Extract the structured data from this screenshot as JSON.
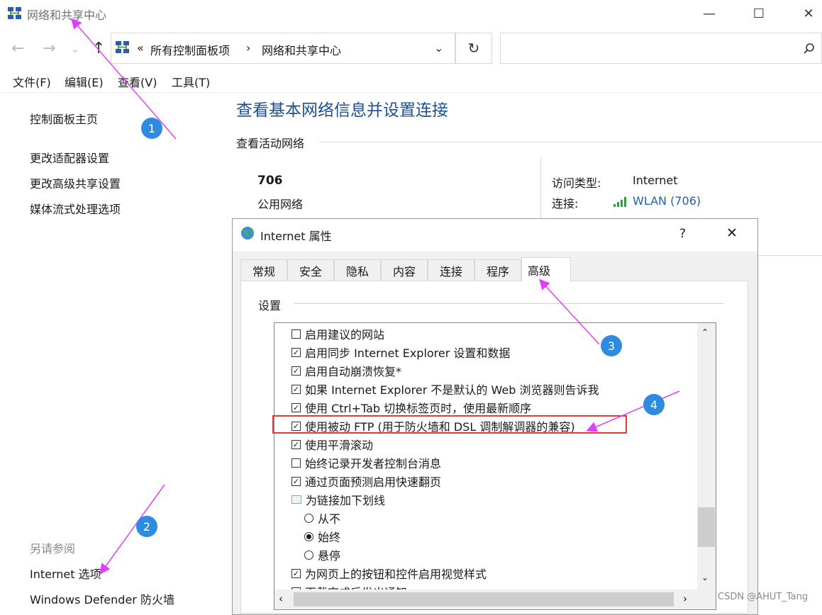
{
  "window": {
    "title": "网络和共享中心",
    "buttons": {
      "minimize": "—",
      "maximize": "☐",
      "close": "✕"
    }
  },
  "address": {
    "chevron": "«",
    "crumbs": [
      "所有控制面板项",
      "网络和共享中心"
    ],
    "separator": "›",
    "refresh": "↻",
    "search_icon": "search-icon"
  },
  "menu": [
    "文件(F)",
    "编辑(E)",
    "查看(V)",
    "工具(T)"
  ],
  "left_panel": {
    "home": "控制面板主页",
    "links": [
      "更改适配器设置",
      "更改高级共享设置",
      "媒体流式处理选项"
    ],
    "see_also_label": "另请参阅",
    "see_also": [
      "Internet 选项",
      "Windows Defender 防火墙"
    ]
  },
  "main": {
    "title": "查看基本网络信息并设置连接",
    "active_networks_label": "查看活动网络",
    "network_name": "706",
    "network_type": "公用网络",
    "access_type_label": "访问类型:",
    "access_type_value": "Internet",
    "connection_label": "连接:",
    "connection_value": "WLAN (706)"
  },
  "dialog": {
    "title": "Internet 属性",
    "help": "?",
    "close": "✕",
    "tabs": [
      "常规",
      "安全",
      "隐私",
      "内容",
      "连接",
      "程序",
      "高级"
    ],
    "active_tab": "高级",
    "settings_label": "设置",
    "items": [
      {
        "type": "checkbox",
        "checked": false,
        "label": "启用建议的网站"
      },
      {
        "type": "checkbox",
        "checked": true,
        "label": "启用同步 Internet Explorer 设置和数据"
      },
      {
        "type": "checkbox",
        "checked": true,
        "label": "启用自动崩溃恢复*"
      },
      {
        "type": "checkbox",
        "checked": true,
        "label": "如果 Internet Explorer 不是默认的 Web 浏览器则告诉我"
      },
      {
        "type": "checkbox",
        "checked": true,
        "label": "使用 Ctrl+Tab 切换标签页时，使用最新顺序"
      },
      {
        "type": "checkbox",
        "checked": true,
        "label": "使用被动 FTP (用于防火墙和 DSL 调制解调器的兼容)"
      },
      {
        "type": "checkbox",
        "checked": true,
        "label": "使用平滑滚动"
      },
      {
        "type": "checkbox",
        "checked": false,
        "label": "始终记录开发者控制台消息"
      },
      {
        "type": "checkbox",
        "checked": true,
        "label": "通过页面预测启用快速翻页"
      },
      {
        "type": "group",
        "label": "为链接加下划线"
      },
      {
        "type": "radio",
        "checked": false,
        "label": "从不"
      },
      {
        "type": "radio",
        "checked": true,
        "label": "始终"
      },
      {
        "type": "radio",
        "checked": false,
        "label": "悬停"
      },
      {
        "type": "checkbox",
        "checked": true,
        "label": "为网页上的按钮和控件启用视觉样式"
      },
      {
        "type": "checkbox",
        "checked": true,
        "label": "下载完成后发出通知"
      }
    ]
  },
  "annotations": {
    "badges": [
      "1",
      "2",
      "3",
      "4"
    ],
    "arrow_color": "#e040fb",
    "highlight_color": "#e53935",
    "badge_color": "#2f8be0"
  },
  "watermark": "CSDN @AHUT_Tang"
}
